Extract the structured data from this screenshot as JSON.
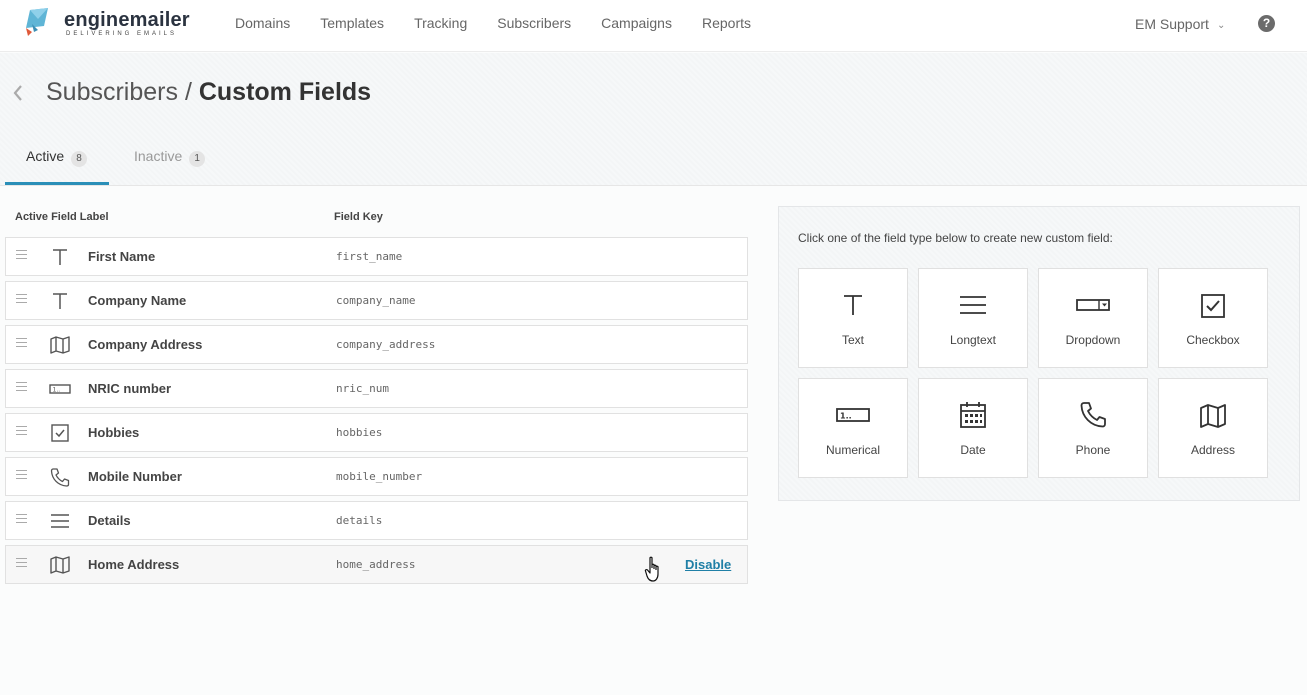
{
  "brand": {
    "name_part1": "engine",
    "name_part2": "mailer",
    "tagline": "DELIVERING EMAILS"
  },
  "nav": [
    {
      "label": "Domains"
    },
    {
      "label": "Templates"
    },
    {
      "label": "Tracking"
    },
    {
      "label": "Subscribers"
    },
    {
      "label": "Campaigns"
    },
    {
      "label": "Reports"
    }
  ],
  "account": {
    "label": "EM Support",
    "help_icon": "?"
  },
  "page": {
    "breadcrumb_parent": "Subscribers",
    "separator": " / ",
    "title": "Custom Fields"
  },
  "tabs": [
    {
      "label": "Active",
      "count": "8",
      "active": true
    },
    {
      "label": "Inactive",
      "count": "1",
      "active": false
    }
  ],
  "table": {
    "col_label": "Active Field Label",
    "col_key": "Field Key",
    "rows": [
      {
        "icon": "text-icon",
        "label": "First Name",
        "key": "first_name"
      },
      {
        "icon": "text-icon",
        "label": "Company Name",
        "key": "company_name"
      },
      {
        "icon": "map-icon",
        "label": "Company Address",
        "key": "company_address"
      },
      {
        "icon": "numerical-icon",
        "label": "NRIC number",
        "key": "nric_num"
      },
      {
        "icon": "checkbox-icon",
        "label": "Hobbies",
        "key": "hobbies"
      },
      {
        "icon": "phone-icon",
        "label": "Mobile Number",
        "key": "mobile_number"
      },
      {
        "icon": "longtext-icon",
        "label": "Details",
        "key": "details"
      },
      {
        "icon": "map-icon",
        "label": "Home Address",
        "key": "home_address",
        "action": "Disable"
      }
    ]
  },
  "panel": {
    "instruction": "Click one of the field type below to create new custom field:",
    "types": [
      {
        "icon": "text-icon",
        "label": "Text"
      },
      {
        "icon": "longtext-icon",
        "label": "Longtext"
      },
      {
        "icon": "dropdown-icon",
        "label": "Dropdown"
      },
      {
        "icon": "checkbox-icon",
        "label": "Checkbox"
      },
      {
        "icon": "numerical-icon",
        "label": "Numerical"
      },
      {
        "icon": "date-icon",
        "label": "Date"
      },
      {
        "icon": "phone-icon",
        "label": "Phone"
      },
      {
        "icon": "map-icon",
        "label": "Address"
      }
    ]
  },
  "colors": {
    "accent": "#2a8fb8",
    "link": "#1f7fa6"
  }
}
